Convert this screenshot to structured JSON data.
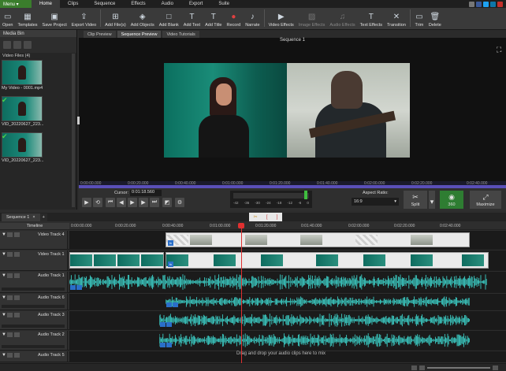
{
  "menubar": {
    "menu_label": "Menu ▾",
    "tabs": [
      "Home",
      "Clips",
      "Sequence",
      "Effects",
      "Audio",
      "Export",
      "Suite"
    ],
    "active_tab": "Home"
  },
  "toolbar": {
    "buttons": [
      {
        "label": "Open",
        "icon": "folder-icon"
      },
      {
        "label": "Templates",
        "icon": "templates-icon"
      },
      {
        "label": "Save Project",
        "icon": "save-icon"
      },
      {
        "label": "Export Video",
        "icon": "export-icon"
      },
      {
        "label": "Add File(s)",
        "icon": "add-file-icon"
      },
      {
        "label": "Add Objects",
        "icon": "add-objects-icon"
      },
      {
        "label": "Add Blank",
        "icon": "add-blank-icon"
      },
      {
        "label": "Add Text",
        "icon": "text-icon"
      },
      {
        "label": "Add Title",
        "icon": "title-icon"
      },
      {
        "label": "Record",
        "icon": "record-icon"
      },
      {
        "label": "Narrate",
        "icon": "microphone-icon"
      },
      {
        "label": "Video Effects",
        "icon": "video-effects-icon"
      },
      {
        "label": "Image Effects",
        "icon": "image-effects-icon"
      },
      {
        "label": "Audio Effects",
        "icon": "audio-effects-icon"
      },
      {
        "label": "Text Effects",
        "icon": "text-effects-icon"
      },
      {
        "label": "Transition",
        "icon": "transition-icon"
      },
      {
        "label": "Trim",
        "icon": "trim-icon"
      },
      {
        "label": "Delete",
        "icon": "delete-icon"
      }
    ]
  },
  "mediabin": {
    "title": "Media Bin",
    "section": "Video Files (4)",
    "items": [
      {
        "label": "My Video - 0001.mp4"
      },
      {
        "label": "VID_20220627_223..."
      },
      {
        "label": "VID_20220627_223..."
      }
    ]
  },
  "preview": {
    "tabs": [
      "Clip Preview",
      "Sequence Preview",
      "Video Tutorials"
    ],
    "active_tab": "Sequence Preview",
    "title": "Sequence 1",
    "ruler_ticks": [
      "0:00:00.000",
      "0:00:20.000",
      "0:00:40.000",
      "0:01:00.000",
      "0:01:20.000",
      "0:01:40.000",
      "0:02:00.000",
      "0:02:20.000",
      "0:02:40.000"
    ]
  },
  "transport": {
    "cursor_label": "Cursor:",
    "cursor_value": "0:01:18.560",
    "level_marks": [
      "-42",
      "-36",
      "-30",
      "-24",
      "-18",
      "-12",
      "-6",
      "0"
    ],
    "aspect_label": "Aspect Ratio:",
    "aspect_value": "16:9",
    "split_label": "Split",
    "btn_360_label": "360",
    "maximize_label": "Maximize"
  },
  "sequence": {
    "tab_label": "Sequence 1",
    "timeline_label": "Timeline",
    "ruler_ticks": [
      "0:00:00.000",
      "0:00:20.000",
      "0:00:40.000",
      "0:01:00.000",
      "0:01:20.000",
      "0:01:40.000",
      "0:02:00.000",
      "0:02:20.000",
      "0:02:40.000"
    ],
    "tracks": [
      {
        "name": "Video Track 4",
        "kind": "video"
      },
      {
        "name": "Video Track 1",
        "kind": "video"
      },
      {
        "name": "Audio Track 1",
        "kind": "audio"
      },
      {
        "name": "Audio Track 6",
        "kind": "audio"
      },
      {
        "name": "Audio Track 3",
        "kind": "audio"
      },
      {
        "name": "Audio Track 2",
        "kind": "audio"
      },
      {
        "name": "Audio Track 5",
        "kind": "audio"
      }
    ],
    "hint": "Drag and drop your audio clips here to mix"
  },
  "colors": {
    "accent_green": "#3a7d2c",
    "waveform": "#3ccfc7",
    "playhead": "#e03030",
    "ruler_fill": "#5a4fb8"
  }
}
